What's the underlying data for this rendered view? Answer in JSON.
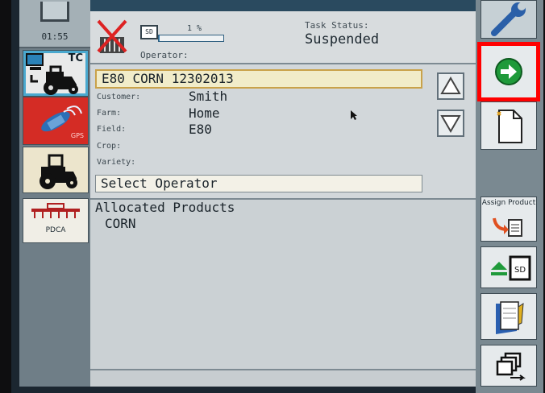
{
  "clock": "01:55",
  "sidebar": {
    "tc_label": "TC",
    "gps_label": "GPS",
    "pdca_label": "PDCA"
  },
  "status": {
    "sd_label": "SD",
    "progress_label": "1 %",
    "progress_value": 0.01,
    "operator_label": "Operator:",
    "task_status_label": "Task Status:",
    "task_status_value": "Suspended"
  },
  "task": {
    "name": "E80 CORN 12302013",
    "fields": [
      {
        "label": "Customer:",
        "value": "Smith"
      },
      {
        "label": "Farm:",
        "value": "Home"
      },
      {
        "label": "Field:",
        "value": "E80"
      },
      {
        "label": "Crop:",
        "value": ""
      },
      {
        "label": "Variety:",
        "value": ""
      }
    ],
    "select_operator": "Select Operator"
  },
  "products": {
    "title": "Allocated Products",
    "items": [
      "CORN"
    ]
  },
  "right_buttons": {
    "assign_product": "Assign Product",
    "sd_label": "SD"
  },
  "colors": {
    "highlight": "#ff0000",
    "next_green": "#1f9a3a",
    "gps_red": "#d42c25",
    "task_box": "#f1ecc9"
  }
}
